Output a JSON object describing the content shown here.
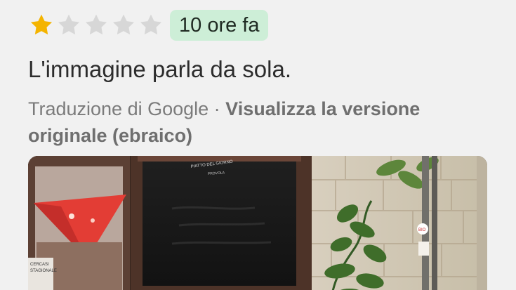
{
  "rating": {
    "value": 1,
    "max": 5,
    "filled_color": "#f4b400",
    "empty_color": "#d7d7d7"
  },
  "time_badge": {
    "label": "10 ore fa",
    "background": "#cdeed7"
  },
  "review": {
    "text": "L'immagine parla da sola."
  },
  "translation": {
    "source_label": "Traduzione di Google",
    "separator": " · ",
    "original_link_label": "Visualizza la versione originale (ebraico)"
  },
  "photo": {
    "icon": "review-photo"
  }
}
